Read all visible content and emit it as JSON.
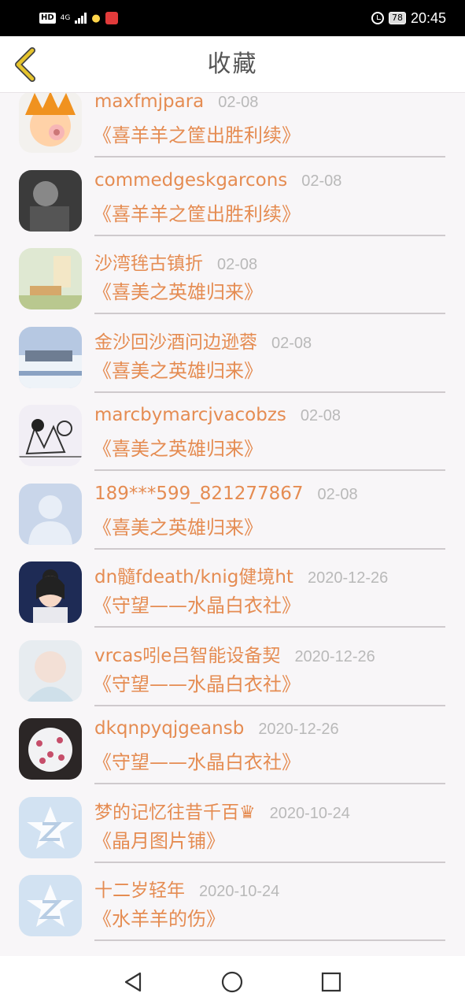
{
  "status_bar": {
    "hd_label": "HD",
    "network_label": "4G",
    "battery": "78",
    "time": "20:45"
  },
  "header": {
    "title": "收藏",
    "back_icon": "chevron-left-icon"
  },
  "colors": {
    "accent": "#e58c52",
    "date": "#b9b9b9",
    "back_arrow": "#e6c42c"
  },
  "favorites": [
    {
      "name": "maxfmjpara",
      "date": "02-08",
      "title": "《喜羊羊之筐出胜利续》",
      "avatar": "cartoon-avatar"
    },
    {
      "name": "commedgeskgarcons",
      "date": "02-08",
      "title": "《喜羊羊之筐出胜利续》",
      "avatar": "photo-avatar"
    },
    {
      "name": "沙湾毪古镇折",
      "date": "02-08",
      "title": "《喜美之英雄归来》",
      "avatar": "photo-avatar"
    },
    {
      "name": "金沙回沙酒问边逊蓉",
      "date": "02-08",
      "title": "《喜美之英雄归来》",
      "avatar": "photo-avatar"
    },
    {
      "name": "marcbymarcjvacobzs",
      "date": "02-08",
      "title": "《喜美之英雄归来》",
      "avatar": "sketch-avatar"
    },
    {
      "name": "189***599_821277867",
      "date": "02-08",
      "title": "《喜美之英雄归来》",
      "avatar": "default-person-avatar"
    },
    {
      "name": "dn髓fdeath/knig健境ht",
      "date": "2020-12-26",
      "title": "《守望——水晶白衣社》",
      "avatar": "illustration-avatar"
    },
    {
      "name": "vrcas吲e吕智能设备契",
      "date": "2020-12-26",
      "title": "《守望——水晶白衣社》",
      "avatar": "photo-avatar"
    },
    {
      "name": "dkqnpyqjgeansb",
      "date": "2020-12-26",
      "title": "《守望——水晶白衣社》",
      "avatar": "flowers-avatar"
    },
    {
      "name": "梦的记忆往昔千百♛",
      "date": "2020-10-24",
      "title": "《晶月图片铺》",
      "avatar": "qq-default-avatar"
    },
    {
      "name": "十二岁轻年",
      "date": "2020-10-24",
      "title": "《水羊羊的伤》",
      "avatar": "qq-default-avatar"
    }
  ],
  "nav_bar": {
    "back": "triangle-back-icon",
    "home": "circle-home-icon",
    "recents": "square-recents-icon"
  }
}
